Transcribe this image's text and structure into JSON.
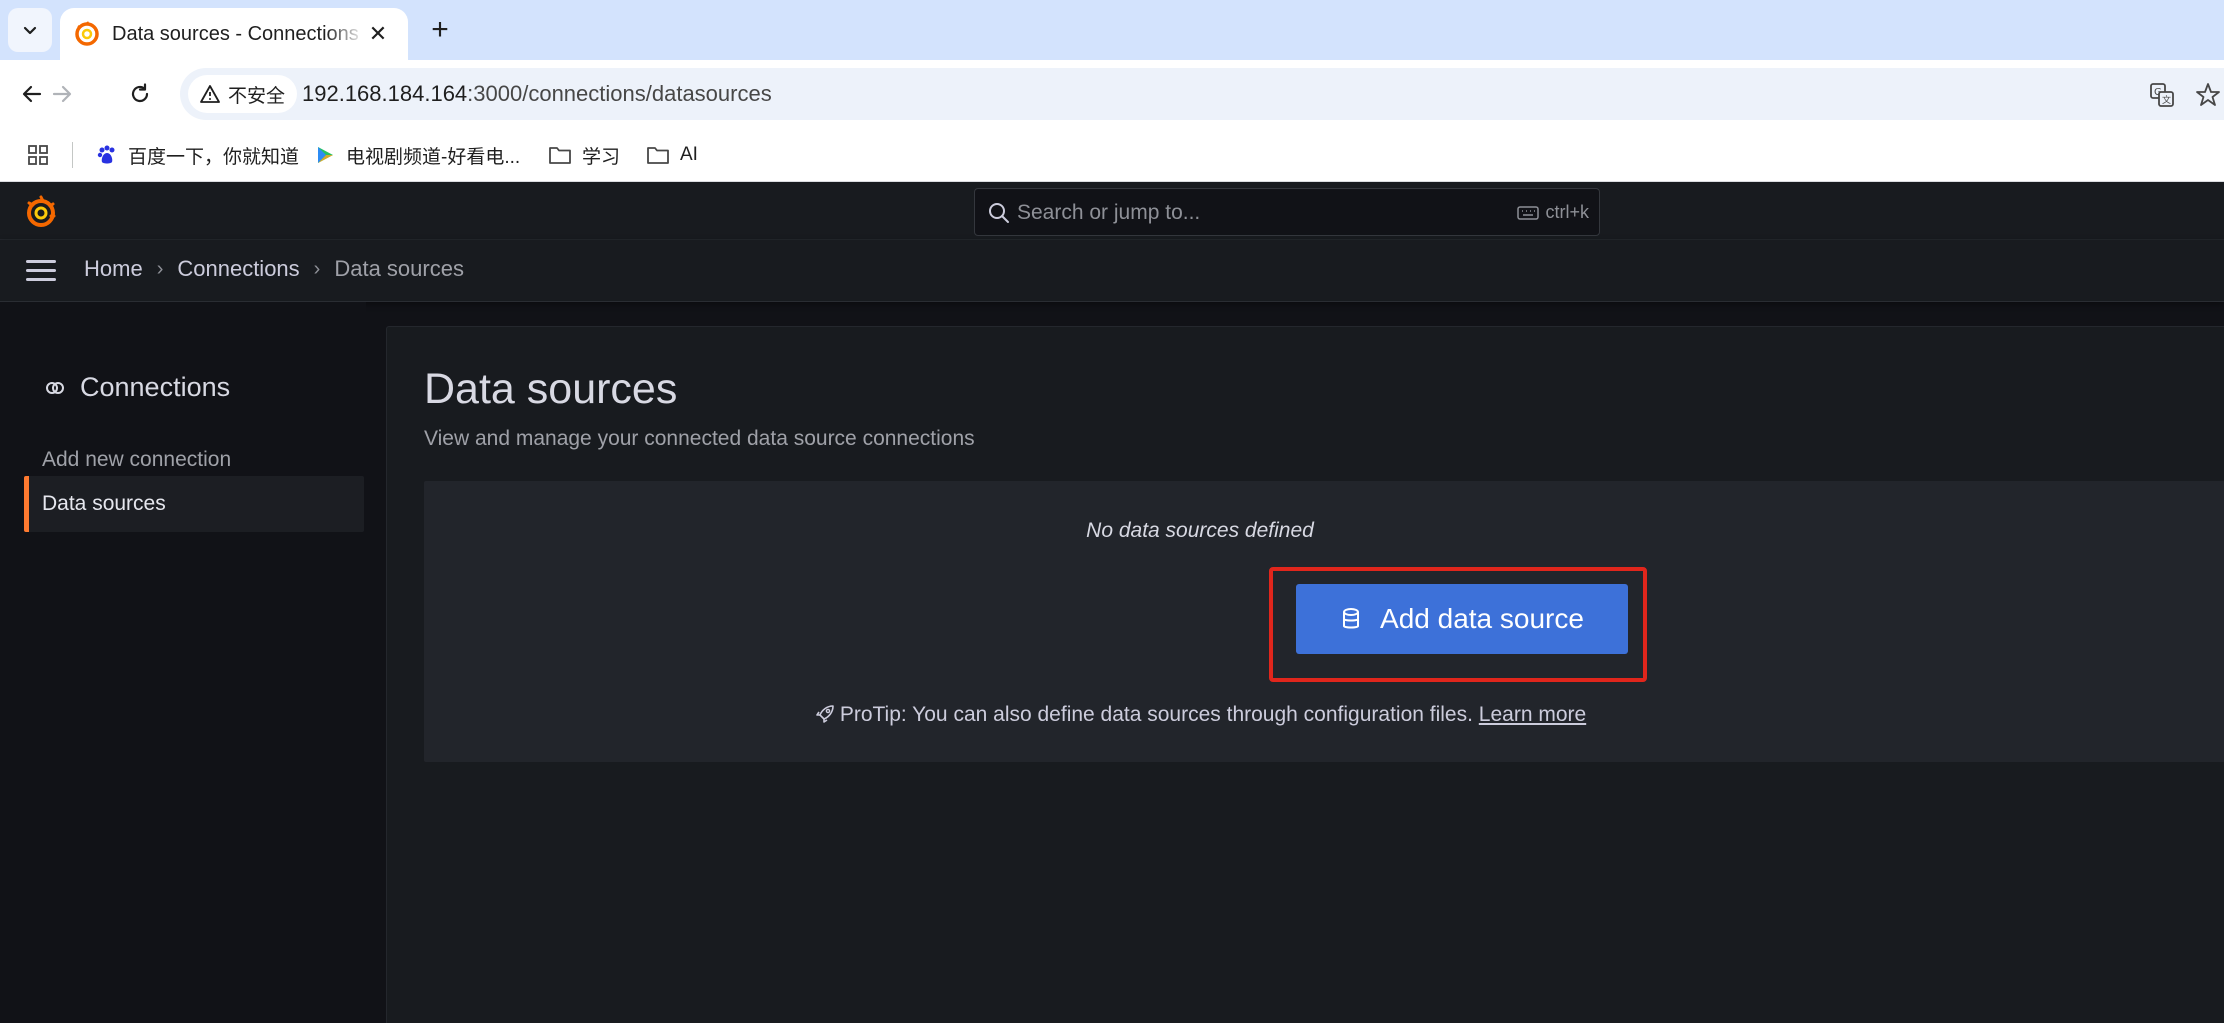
{
  "browser": {
    "tab_title": "Data sources - Connections - Grafana",
    "new_tab_symbol": "+",
    "close_symbol": "✕",
    "security_label": "不安全",
    "url_host": "192.168.184.164",
    "url_path": ":3000/connections/datasources",
    "bookmarks": [
      {
        "label": "百度一下，你就知道",
        "icon": "baidu-icon"
      },
      {
        "label": "电视剧频道-好看电...",
        "icon": "video-play-icon"
      },
      {
        "label": "学习",
        "icon": "folder-icon"
      },
      {
        "label": "AI",
        "icon": "folder-icon"
      }
    ]
  },
  "grafana": {
    "search_placeholder": "Search or jump to...",
    "search_shortcut": "ctrl+k",
    "breadcrumbs": [
      "Home",
      "Connections",
      "Data sources"
    ],
    "breadcrumb_separator": "›",
    "sidebar": {
      "title": "Connections",
      "items": [
        {
          "label": "Add new connection",
          "active": false
        },
        {
          "label": "Data sources",
          "active": true
        }
      ]
    },
    "page": {
      "title": "Data sources",
      "subtitle": "View and manage your connected data source connections",
      "empty_message": "No data sources defined",
      "add_button_label": "Add data source",
      "protip_text": "ProTip: You can also define data sources through configuration files.",
      "protip_link": "Learn more"
    },
    "colors": {
      "accent_orange": "#ff7a30",
      "primary_button": "#3d71d9",
      "highlight_frame": "#e1261c"
    }
  }
}
